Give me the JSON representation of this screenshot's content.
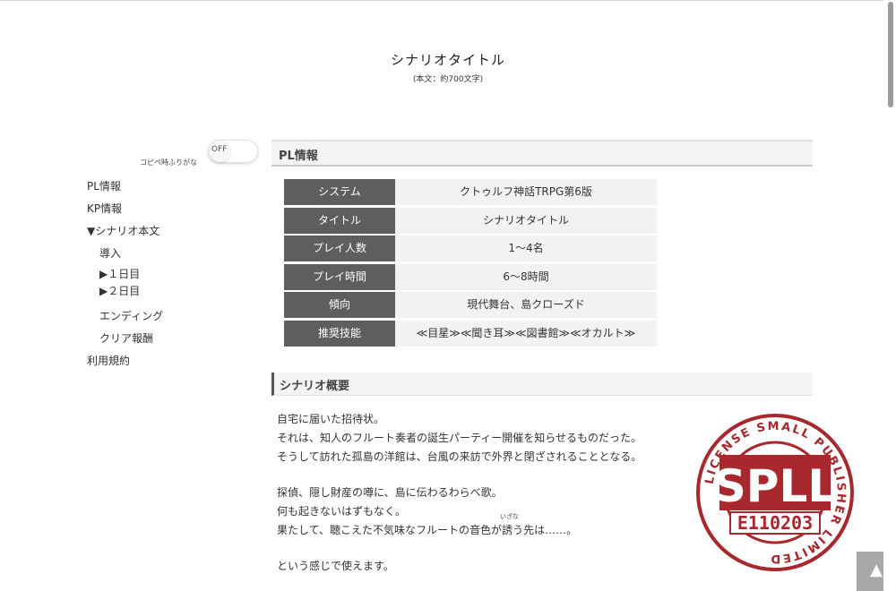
{
  "header": {
    "title": "シナリオタイトル",
    "subtitle": "(本文：約700文字)"
  },
  "toggle": {
    "label": "コピペ時ふりがな",
    "state": "OFF"
  },
  "sidebar": {
    "items": [
      {
        "label": "PL情報"
      },
      {
        "label": "KP情報"
      },
      {
        "label": "▼シナリオ本文"
      },
      {
        "label": "導入"
      },
      {
        "label": "▶︎１日目"
      },
      {
        "label": "▶︎２日目"
      },
      {
        "label": "エンディング"
      },
      {
        "label": "クリア報酬"
      },
      {
        "label": "利用規約"
      }
    ]
  },
  "sections": {
    "pl_info": "PL情報",
    "overview": "シナリオ概要"
  },
  "info_table": [
    {
      "key": "システム",
      "value": "クトゥルフ神話TRPG第6版"
    },
    {
      "key": "タイトル",
      "value": "シナリオタイトル"
    },
    {
      "key": "プレイ人数",
      "value": "1〜4名"
    },
    {
      "key": "プレイ時間",
      "value": "6〜8時間"
    },
    {
      "key": "傾向",
      "value": "現代舞台、島クローズド"
    },
    {
      "key": "推奨技能",
      "value": "≪目星≫≪聞き耳≫≪図書館≫≪オカルト≫"
    }
  ],
  "overview": {
    "lines": [
      "自宅に届いた招待状。",
      "それは、知人のフルート奏者の誕生パーティー開催を知らせるものだった。",
      "そうして訪れた孤島の洋館は、台風の来訪で外界と閉ざされることとなる。",
      "探偵、隠し財産の噂に、島に伝わるわらべ歌。",
      "何も起きないはずもなく。",
      "果たして、聴こえた不気味なフルートの音色が",
      "誘",
      "う先は……。",
      "という感じで使えます。"
    ],
    "ruby": "いざな"
  },
  "stamp": {
    "arc_text": "LICENSE SMALL PUBLISHER LIMITED",
    "logo": "SPLL",
    "code": "E110203"
  },
  "colors": {
    "stamp_red": "#a8282d",
    "table_key_bg": "#5e5e5e",
    "table_value_bg": "#f2f2f2"
  },
  "back_to_top": "▲"
}
